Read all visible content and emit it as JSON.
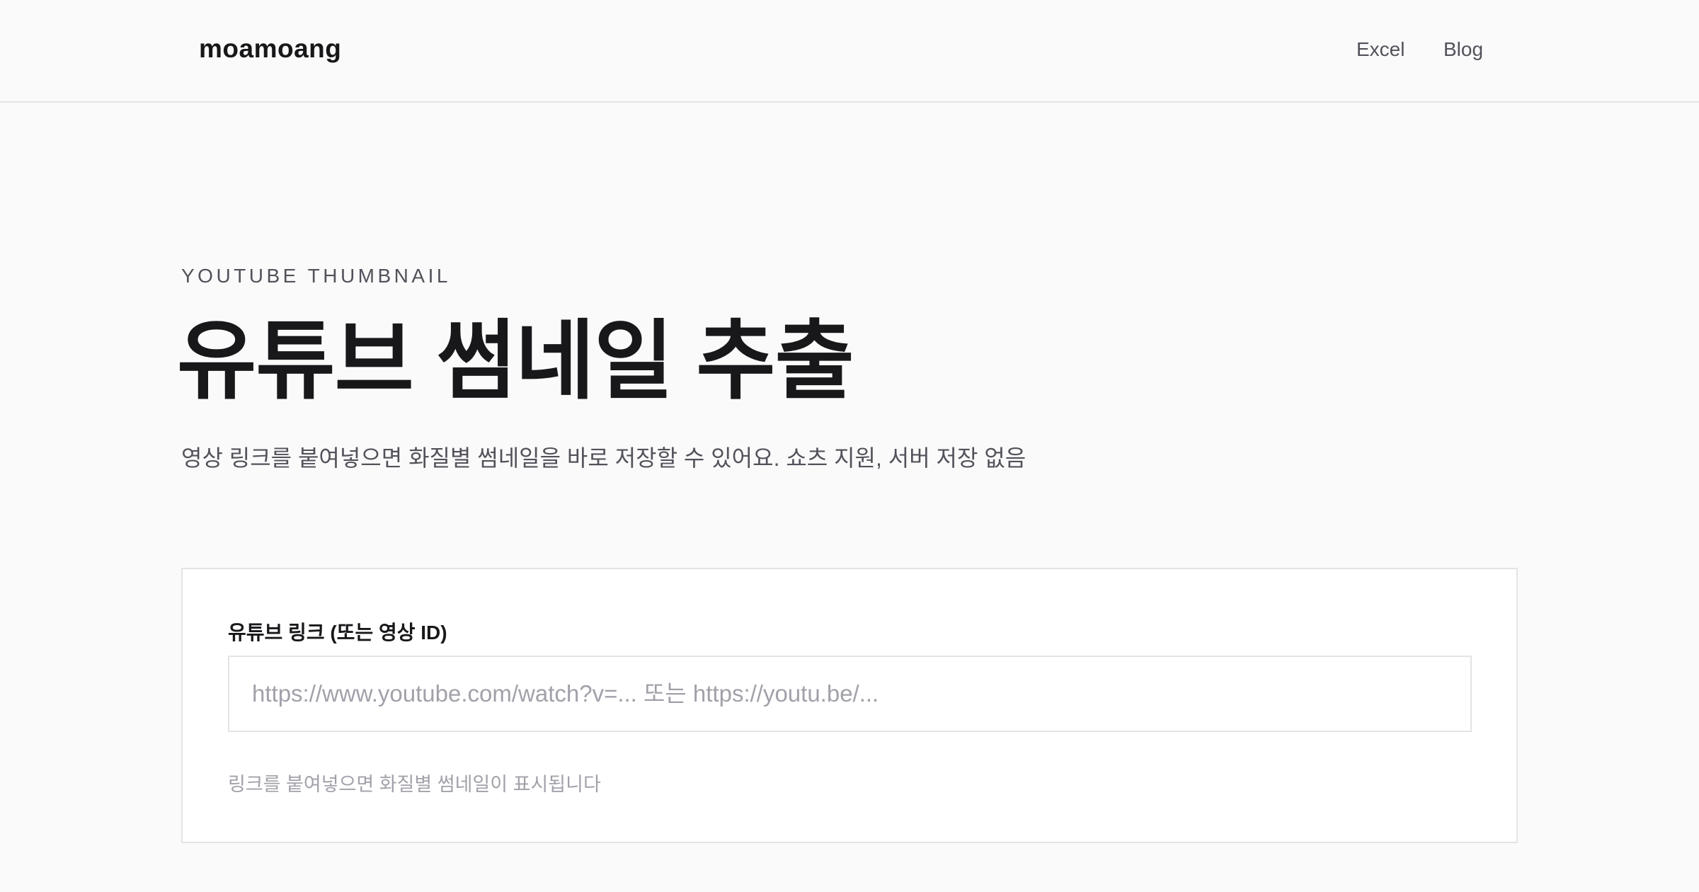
{
  "header": {
    "logo": "moamoang",
    "nav": {
      "excel": "Excel",
      "blog": "Blog"
    }
  },
  "hero": {
    "eyebrow": "YOUTUBE THUMBNAIL",
    "title": "유튜브 썸네일 추출",
    "subtitle": "영상 링크를 붙여넣으면 화질별 썸네일을 바로 저장할 수 있어요. 쇼츠 지원, 서버 저장 없음"
  },
  "form": {
    "label": "유튜브 링크 (또는 영상 ID)",
    "input_value": "",
    "input_placeholder": "https://www.youtube.com/watch?v=... 또는 https://youtu.be/...",
    "hint": "링크를 붙여넣으면 화질별 썸네일이 표시됩니다"
  }
}
